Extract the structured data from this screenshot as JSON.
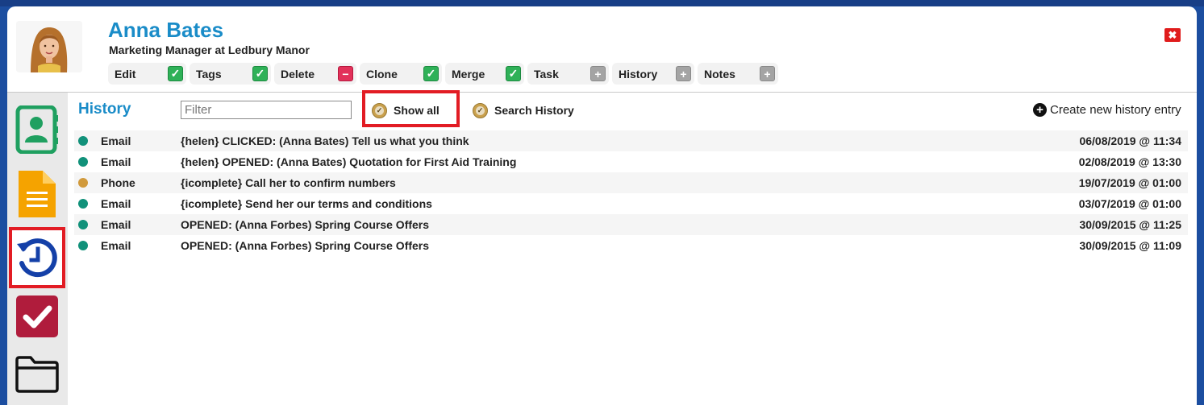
{
  "contact": {
    "name": "Anna Bates",
    "title": "Marketing Manager at Ledbury Manor"
  },
  "actions": [
    {
      "label": "Edit",
      "icon": "check-icon",
      "status": "check"
    },
    {
      "label": "Tags",
      "icon": "check-icon",
      "status": "check"
    },
    {
      "label": "Delete",
      "icon": "minus-icon",
      "status": "minus"
    },
    {
      "label": "Clone",
      "icon": "check-icon",
      "status": "check"
    },
    {
      "label": "Merge",
      "icon": "check-icon",
      "status": "check"
    },
    {
      "label": "Task",
      "icon": "plus-icon",
      "status": "plus"
    },
    {
      "label": "History",
      "icon": "plus-icon",
      "status": "plus"
    },
    {
      "label": "Notes",
      "icon": "plus-icon",
      "status": "plus"
    }
  ],
  "sidebar": {
    "items": [
      {
        "icon": "contact-card-icon",
        "color": "#1fa060"
      },
      {
        "icon": "document-icon",
        "color": "#f5a300"
      },
      {
        "icon": "history-icon",
        "color": "#1440a8",
        "selected": true
      },
      {
        "icon": "task-check-icon",
        "color": "#b01c3c"
      },
      {
        "icon": "folder-icon",
        "color": "#111111"
      }
    ]
  },
  "history": {
    "title": "History",
    "filter_placeholder": "Filter",
    "filter_value": "",
    "show_all_label": "Show all",
    "search_history_label": "Search History",
    "create_label": "Create new history entry",
    "rows": [
      {
        "type": "Email",
        "dot_color": "#11917a",
        "description": "{helen} CLICKED: (Anna Bates) Tell us what you think",
        "date": "06/08/2019 @ 11:34"
      },
      {
        "type": "Email",
        "dot_color": "#11917a",
        "description": "{helen} OPENED: (Anna Bates) Quotation for First Aid Training",
        "date": "02/08/2019 @ 13:30"
      },
      {
        "type": "Phone",
        "dot_color": "#d19a3c",
        "description": "{icomplete} Call her to confirm numbers",
        "date": "19/07/2019 @ 01:00"
      },
      {
        "type": "Email",
        "dot_color": "#11917a",
        "description": "{icomplete} Send her our terms and conditions",
        "date": "03/07/2019 @ 01:00"
      },
      {
        "type": "Email",
        "dot_color": "#11917a",
        "description": "OPENED: (Anna Forbes) Spring Course Offers",
        "date": "30/09/2015 @ 11:25"
      },
      {
        "type": "Email",
        "dot_color": "#11917a",
        "description": "OPENED: (Anna Forbes) Spring Course Offers",
        "date": "30/09/2015 @ 11:09"
      }
    ]
  },
  "colors": {
    "accent": "#1a8cc8",
    "highlight": "#e21c24",
    "background": "#1d54b0"
  }
}
